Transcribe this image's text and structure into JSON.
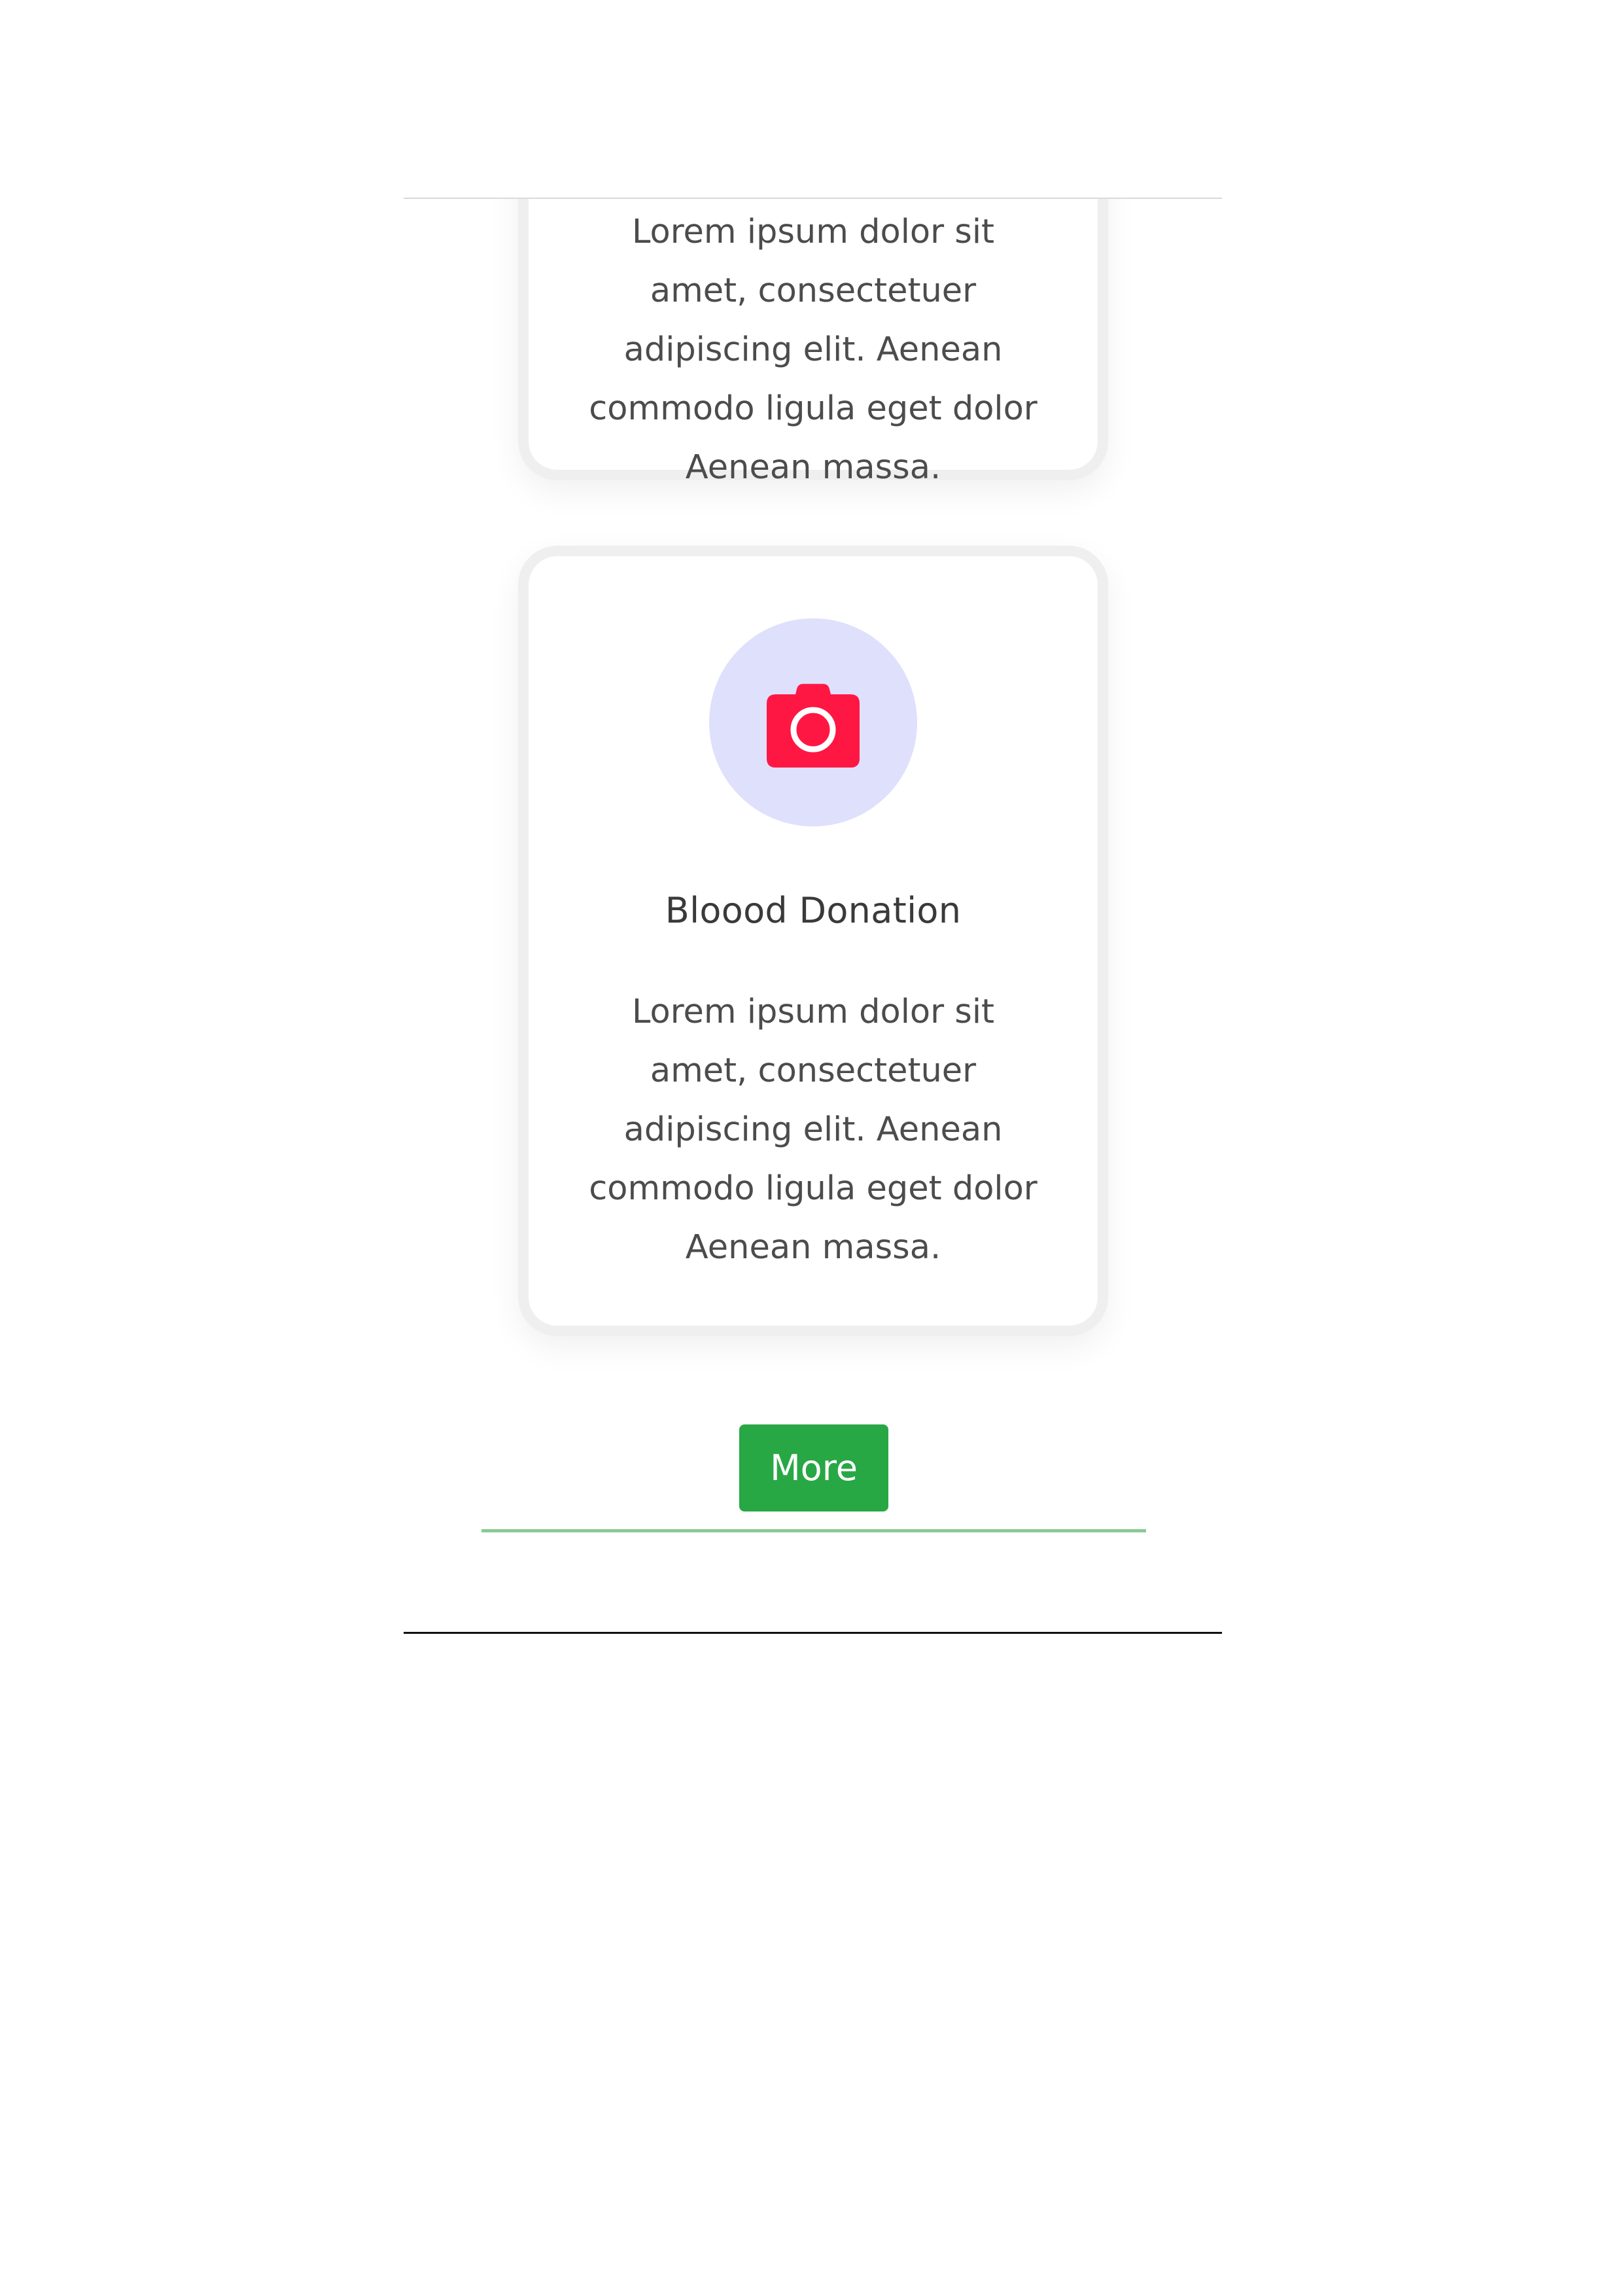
{
  "cards": [
    {
      "title": "",
      "text": "Lorem ipsum dolor sit amet, consectetuer adipiscing elit. Aenean commodo ligula eget dolor Aenean massa."
    },
    {
      "icon": "camera-icon",
      "title": "Bloood Donation",
      "text": "Lorem ipsum dolor sit amet, consectetuer adipiscing elit. Aenean commodo ligula eget dolor Aenean massa."
    }
  ],
  "more_button": {
    "label": "More"
  },
  "colors": {
    "accent_green": "#28a745",
    "icon_red": "#ff1744",
    "icon_bg": "#dfe0fc"
  }
}
